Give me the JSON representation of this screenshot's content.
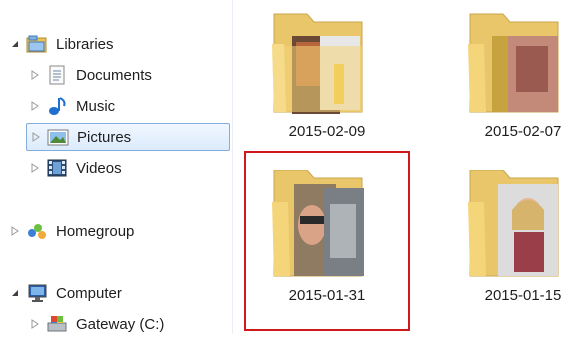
{
  "navigation": {
    "libraries": {
      "label": "Libraries",
      "icon": "libraries-icon",
      "expanded": true
    },
    "library_items": [
      {
        "label": "Documents",
        "icon": "documents-icon"
      },
      {
        "label": "Music",
        "icon": "music-icon"
      },
      {
        "label": "Pictures",
        "icon": "pictures-icon",
        "selected": true
      },
      {
        "label": "Videos",
        "icon": "videos-icon"
      }
    ],
    "homegroup": {
      "label": "Homegroup",
      "icon": "homegroup-icon"
    },
    "computer": {
      "label": "Computer",
      "icon": "computer-icon",
      "expanded": true
    },
    "drives": [
      {
        "label": "Gateway (C:)",
        "icon": "drive-icon"
      }
    ]
  },
  "folders": [
    {
      "name": "2015-02-09"
    },
    {
      "name": "2015-02-07"
    },
    {
      "name": "2015-01-31",
      "highlighted": true
    },
    {
      "name": "2015-01-15"
    }
  ],
  "colors": {
    "selection_border": "#84acdd",
    "highlight_border": "#d0191a",
    "folder_yellow": "#f4d57a"
  }
}
